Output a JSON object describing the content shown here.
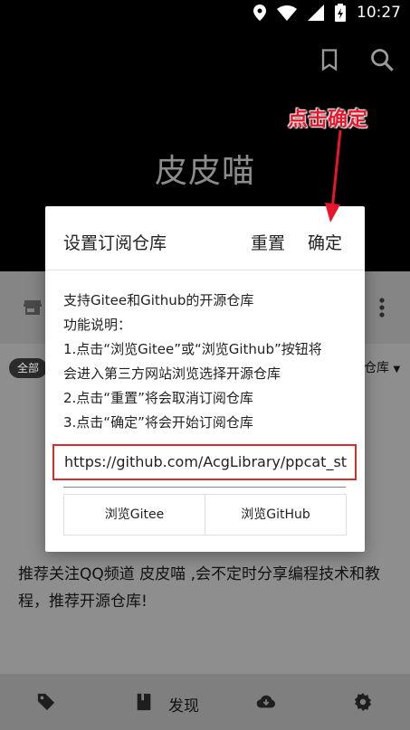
{
  "status_bar": {
    "time": "10:27",
    "icons": [
      "location-icon",
      "wifi-icon",
      "signal-icon",
      "battery-charging-icon"
    ]
  },
  "header": {
    "app_title": "皮皮喵",
    "actions": [
      "bookmark-icon",
      "search-icon"
    ]
  },
  "annotation": {
    "label": "点击确定",
    "color": "#e8162b"
  },
  "background_page": {
    "filter_chip": "全部",
    "repo_select": "仓库",
    "description": "推荐关注QQ频道 皮皮喵 ,会不定时分享编程技术和教程，推荐开源仓库!"
  },
  "dialog": {
    "title": "设置订阅仓库",
    "reset_label": "重置",
    "confirm_label": "确定",
    "body_lines": [
      "支持Gitee和Github的开源仓库",
      "功能说明：",
      "1.点击“浏览Gitee”或“浏览Github”按钮将",
      "会进入第三方网站浏览选择开源仓库",
      "2.点击“重置”将会取消订阅仓库",
      "3.点击“确定”将会开始订阅仓库"
    ],
    "url_value": "https://github.com/AcgLibrary/ppcat_st",
    "browse_gitee_label": "浏览Gitee",
    "browse_github_label": "浏览GitHub"
  },
  "bottom_nav": {
    "items": [
      {
        "icon": "tag-icon",
        "label": ""
      },
      {
        "icon": "book-icon",
        "label": "发现"
      },
      {
        "icon": "cloud-download-icon",
        "label": ""
      },
      {
        "icon": "gear-icon",
        "label": ""
      }
    ]
  }
}
